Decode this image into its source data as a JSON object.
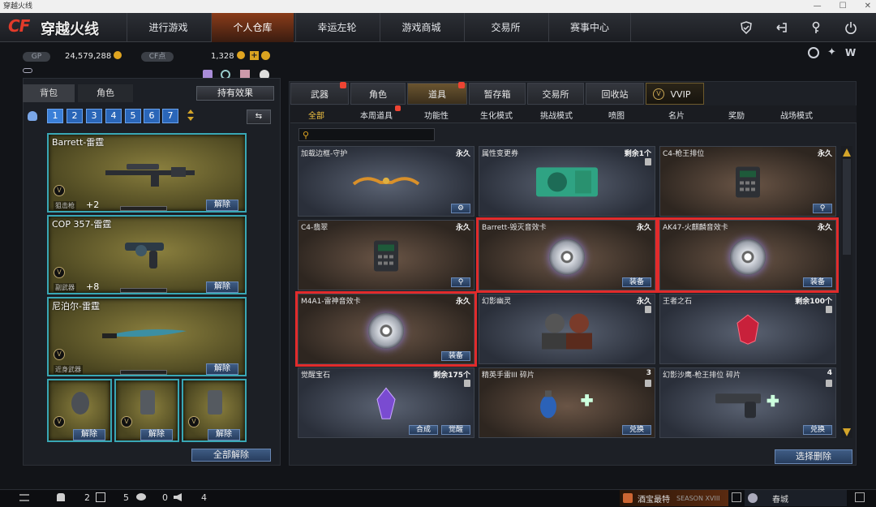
{
  "window": {
    "title": "穿越火线"
  },
  "topnav": {
    "logo_cf": "CF",
    "logo_text": "穿越火线",
    "tabs": [
      {
        "label": "进行游戏"
      },
      {
        "label": "个人仓库",
        "active": true
      },
      {
        "label": "幸运左轮"
      },
      {
        "label": "游戏商城"
      },
      {
        "label": "交易所"
      },
      {
        "label": "赛事中心"
      }
    ],
    "icons": [
      "shield-icon",
      "exit-icon",
      "key-icon",
      "power-icon"
    ]
  },
  "currency": {
    "gp_label": "GP",
    "gp_value": "24,579,288",
    "cf_label": "CF点",
    "cf_value": "1,328"
  },
  "left": {
    "subtabs": [
      "背包",
      "角色"
    ],
    "effects_button": "持有效果",
    "pages": [
      "1",
      "2",
      "3",
      "4",
      "5",
      "6",
      "7"
    ],
    "weapons": [
      {
        "name": "Barrett-雷霆",
        "type": "狙击枪",
        "plus": "+2",
        "button": "解除"
      },
      {
        "name": "COP 357-雷霆",
        "type": "副武器",
        "plus": "+8",
        "button": "解除"
      },
      {
        "name": "尼泊尔-雷霆",
        "type": "近身武器",
        "plus": "",
        "button": "解除"
      }
    ],
    "grenades": [
      {
        "button": "解除"
      },
      {
        "button": "解除"
      },
      {
        "button": "解除"
      }
    ],
    "unequip_all": "全部解除"
  },
  "right": {
    "tabs": [
      {
        "label": "武器",
        "hot": true
      },
      {
        "label": "角色"
      },
      {
        "label": "道具",
        "active": true,
        "hot": true
      },
      {
        "label": "暂存箱"
      },
      {
        "label": "交易所"
      },
      {
        "label": "回收站"
      },
      {
        "label": "VVIP"
      }
    ],
    "filters": [
      {
        "label": "全部",
        "active": true
      },
      {
        "label": "本周道具",
        "hot": true
      },
      {
        "label": "功能性"
      },
      {
        "label": "生化模式"
      },
      {
        "label": "挑战模式"
      },
      {
        "label": "喷图"
      },
      {
        "label": "名片"
      },
      {
        "label": "奖励"
      },
      {
        "label": "战场模式"
      }
    ],
    "items": [
      {
        "name": "加载边框-守护",
        "dur": "永久",
        "buttons": [],
        "gear": true,
        "pic": "frame",
        "warm": false
      },
      {
        "name": "属性变更券",
        "dur": "剩余1个",
        "buttons": [],
        "pic": "ticket",
        "warm": false
      },
      {
        "name": "C4-枪王排位",
        "dur": "永久",
        "buttons": [],
        "search": true,
        "pic": "c4",
        "warm": true
      },
      {
        "name": "C4-翡翠",
        "dur": "永久",
        "buttons": [],
        "search": true,
        "pic": "c4",
        "warm": true
      },
      {
        "name": "Barrett-毁灭音效卡",
        "dur": "永久",
        "buttons": [
          "装备"
        ],
        "pic": "cd",
        "warm": true,
        "selected": true
      },
      {
        "name": "AK47-火麒麟音效卡",
        "dur": "永久",
        "buttons": [
          "装备"
        ],
        "pic": "cd",
        "warm": true,
        "selected": true
      },
      {
        "name": "M4A1-雷神音效卡",
        "dur": "永久",
        "buttons": [
          "装备"
        ],
        "pic": "cd",
        "warm": true,
        "selected": true
      },
      {
        "name": "幻影幽灵",
        "dur": "永久",
        "buttons": [],
        "pic": "chars",
        "warm": false
      },
      {
        "name": "王者之石",
        "dur": "剩余100个",
        "buttons": [],
        "pic": "gem-red",
        "warm": false
      },
      {
        "name": "觉醒宝石",
        "dur": "剩余175个",
        "buttons": [
          "合成",
          "觉醒"
        ],
        "pic": "gem-purple",
        "warm": false
      },
      {
        "name": "精英手雷III 碎片",
        "dur": "3",
        "buttons": [
          "兑换"
        ],
        "pic": "grenade",
        "warm": true
      },
      {
        "name": "幻影沙鹰-枪王排位 碎片",
        "dur": "4",
        "buttons": [
          "兑换"
        ],
        "pic": "pistol",
        "warm": false
      }
    ],
    "select_delete": "选择删除"
  },
  "bottom": {
    "stats": [
      {
        "icon": "friends-icon",
        "value": "2"
      },
      {
        "icon": "clan-icon",
        "value": "5"
      },
      {
        "icon": "chat-icon",
        "value": "0"
      },
      {
        "icon": "speaker-icon",
        "value": "4"
      }
    ],
    "promo1": "酒宝最特",
    "season": "SEASON XVIII",
    "promo2": "春城"
  }
}
